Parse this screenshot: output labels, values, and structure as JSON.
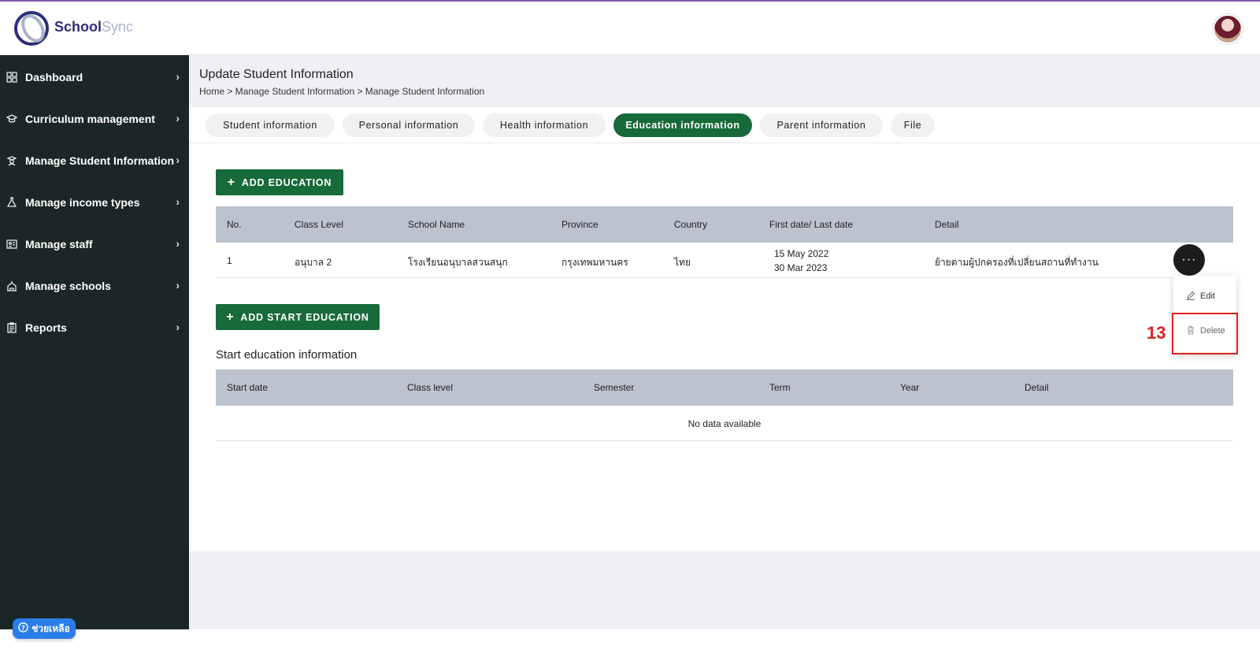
{
  "brand": {
    "name_part1": "School",
    "name_part2": "Sync"
  },
  "sidebar": {
    "items": [
      {
        "label": "Dashboard",
        "icon": "grid-icon"
      },
      {
        "label": "Curriculum management",
        "icon": "graduation-cap-icon"
      },
      {
        "label": "Manage Student Information",
        "icon": "student-icon"
      },
      {
        "label": "Manage income types",
        "icon": "flask-icon"
      },
      {
        "label": "Manage staff",
        "icon": "id-card-icon"
      },
      {
        "label": "Manage schools",
        "icon": "building-icon"
      },
      {
        "label": "Reports",
        "icon": "clipboard-icon"
      }
    ]
  },
  "help": {
    "label": "ช่วยเหลือ"
  },
  "page": {
    "title": "Update Student Information",
    "breadcrumb": "Home > Manage Student Information > Manage Student Information"
  },
  "tabs": [
    {
      "label": "Student information",
      "active": false
    },
    {
      "label": "Personal information",
      "active": false
    },
    {
      "label": "Health information",
      "active": false
    },
    {
      "label": "Education information",
      "active": true
    },
    {
      "label": "Parent information",
      "active": false
    },
    {
      "label": "File",
      "active": false
    }
  ],
  "education": {
    "add_button": "ADD EDUCATION",
    "columns": [
      "No.",
      "Class Level",
      "School Name",
      "Province",
      "Country",
      "First date/ Last date",
      "Detail"
    ],
    "rows": [
      {
        "no": "1",
        "class_level": "อนุบาล 2",
        "school_name": "โรงเรียนอนุบาลสวนสนุก",
        "province": "กรุงเทพมหานคร",
        "country": "ไทย",
        "first_date": "15 May 2022",
        "last_date": "30 Mar 2023",
        "detail": "ย้ายตามผู้ปกครองที่เปลี่ยนสถานที่ทำงาน"
      }
    ]
  },
  "row_menu": {
    "button_label": "···",
    "edit_label": "Edit",
    "delete_label": "Delete"
  },
  "annotation": {
    "step": "13"
  },
  "start_education": {
    "add_button": "ADD START EDUCATION",
    "title": "Start education information",
    "columns": [
      "Start date",
      "Class level",
      "Semester",
      "Term",
      "Year",
      "Detail"
    ],
    "empty_text": "No data available"
  },
  "colors": {
    "sidebar_bg": "#1a2726",
    "primary_green": "#176a3a",
    "table_header": "#bcc3cf",
    "highlight_red": "#e02020",
    "help_blue": "#2b7de9"
  }
}
